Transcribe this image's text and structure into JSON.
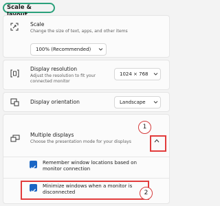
{
  "section_title": "Scale & layout",
  "scale": {
    "title": "Scale",
    "description": "Change the size of text, apps, and other items",
    "value": "100% (Recommended)"
  },
  "resolution": {
    "title": "Display resolution",
    "description_line1": "Adjust the resolution to fit your",
    "description_line2": "connected monitor",
    "value": "1024 × 768"
  },
  "orientation": {
    "title": "Display orientation",
    "value": "Landscape"
  },
  "multiple_displays": {
    "title": "Multiple displays",
    "description": "Choose the presentation mode for your displays",
    "options": [
      {
        "line1": "Remember window locations based on",
        "line2": "monitor connection",
        "checked": true
      },
      {
        "line1": "Minimize windows when a monitor is",
        "line2": "disconnected",
        "checked": true
      }
    ]
  },
  "annotations": {
    "badge1": "1",
    "badge2": "2"
  },
  "colors": {
    "accent": "#1a66c5",
    "highlight_red": "#e23b3b",
    "section_outline": "#2aa07a"
  }
}
